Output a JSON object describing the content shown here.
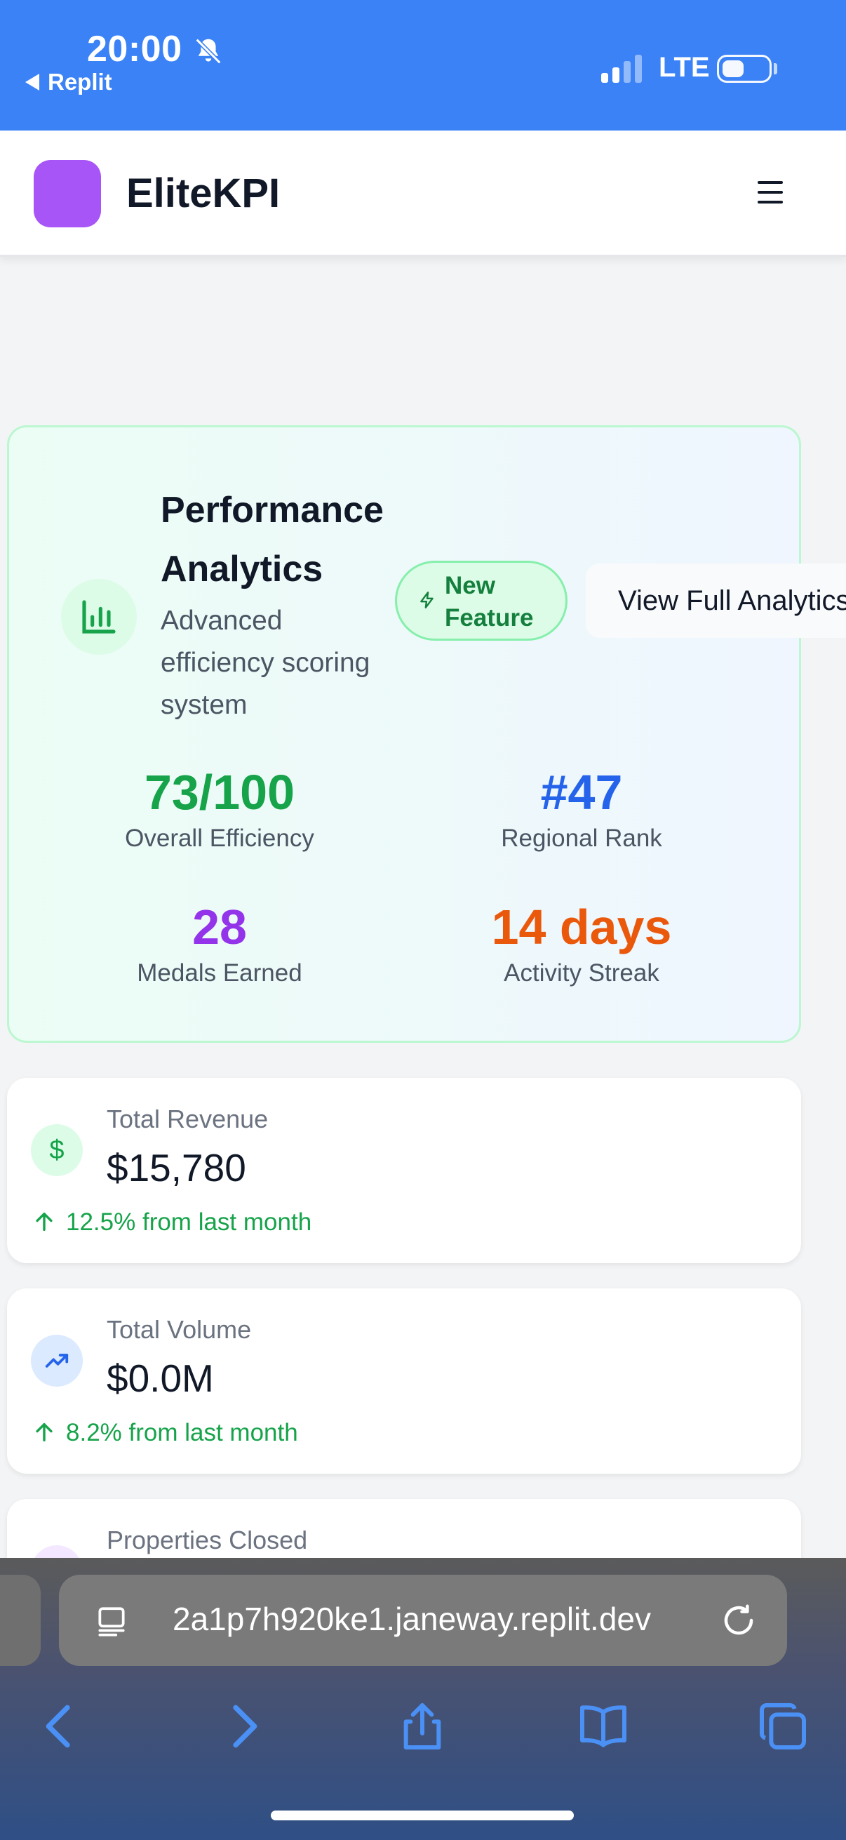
{
  "status_bar": {
    "time": "20:00",
    "back_app": "Replit",
    "network": "LTE"
  },
  "header": {
    "brand": "EliteKPI",
    "logo_color": "#a855f7",
    "menu_icon": "hamburger-menu-icon"
  },
  "analytics": {
    "title_line1": "Performance",
    "title_line2": "Analytics",
    "subtitle": "Advanced efficiency scoring system",
    "badge_icon": "bar-chart-icon",
    "new_feature_line1": "New",
    "new_feature_line2": "Feature",
    "new_feature_icon": "lightning-icon",
    "view_button": "View Full Analytics",
    "metrics": [
      {
        "value": "73/100",
        "label": "Overall Efficiency",
        "color": "#16a34a"
      },
      {
        "value": "#47",
        "label": "Regional Rank",
        "color": "#2563eb"
      },
      {
        "value": "28",
        "label": "Medals Earned",
        "color": "#9333ea"
      },
      {
        "value": "14 days",
        "label": "Activity Streak",
        "color": "#ea580c"
      }
    ]
  },
  "stats": [
    {
      "label": "Total Revenue",
      "value": "$15,780",
      "change": "12.5% from last month",
      "icon": "dollar-icon",
      "icon_bg": "#dcfce7",
      "icon_color": "#16a34a"
    },
    {
      "label": "Total Volume",
      "value": "$0.0M",
      "change": "8.2% from last month",
      "icon": "trending-up-icon",
      "icon_bg": "#dbeafe",
      "icon_color": "#2563eb"
    },
    {
      "label": "Properties Closed",
      "icon_bg": "#f3e8ff"
    }
  ],
  "browser": {
    "url": "2a1p7h920ke1.janeway.replit.dev"
  }
}
